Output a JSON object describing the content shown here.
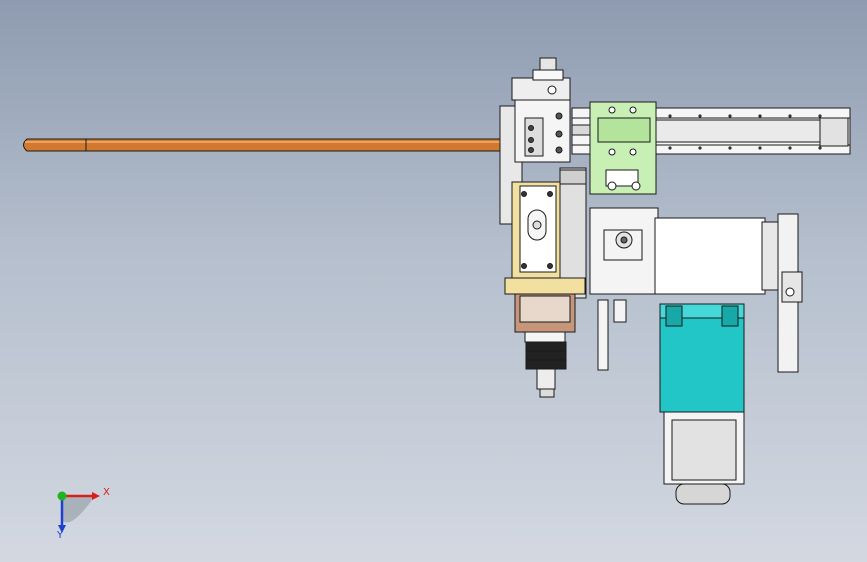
{
  "viewport": {
    "background_top": "#8e9bb0",
    "background_bottom": "#d3d8e1"
  },
  "model": {
    "parts": [
      "copper-rod",
      "linear-slide",
      "vertical-carriage",
      "clamp-block",
      "servo-motor",
      "gearbox",
      "spindle",
      "mounting-bracket"
    ],
    "colors": {
      "copper_rod": "#d0792f",
      "slide_carriage": "#c8f0b4",
      "clamp_block": "#f2e0a0",
      "gearbox": "#22c6c6",
      "metal": "#f2f2f2",
      "edge": "#1a1a1a"
    }
  },
  "triad": {
    "x_label": "X",
    "y_label": "Y",
    "x_color": "#d81e1e",
    "y_color": "#1f3fd0",
    "z_color": "#22b322"
  }
}
